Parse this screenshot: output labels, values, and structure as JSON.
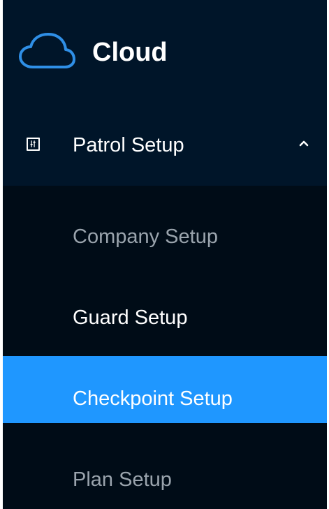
{
  "brand": {
    "title": "Cloud",
    "logo_icon": "cloud-icon"
  },
  "menu": {
    "header": {
      "label": "Patrol Setup",
      "icon": "sliders-icon",
      "expanded": true,
      "chevron_icon": "chevron-up-icon"
    },
    "items": [
      {
        "label": "Company Setup",
        "selected": false
      },
      {
        "label": "Guard Setup",
        "selected": false
      },
      {
        "label": "Checkpoint Setup",
        "selected": true
      },
      {
        "label": "Plan Setup",
        "selected": false
      }
    ]
  },
  "colors": {
    "sidebar_bg": "#001529",
    "submenu_bg": "#000c17",
    "selected_bg": "#1f97ff",
    "logo": "#2f8fe6",
    "muted_text": "#9aa4ad",
    "accent": "#3a48ff"
  }
}
